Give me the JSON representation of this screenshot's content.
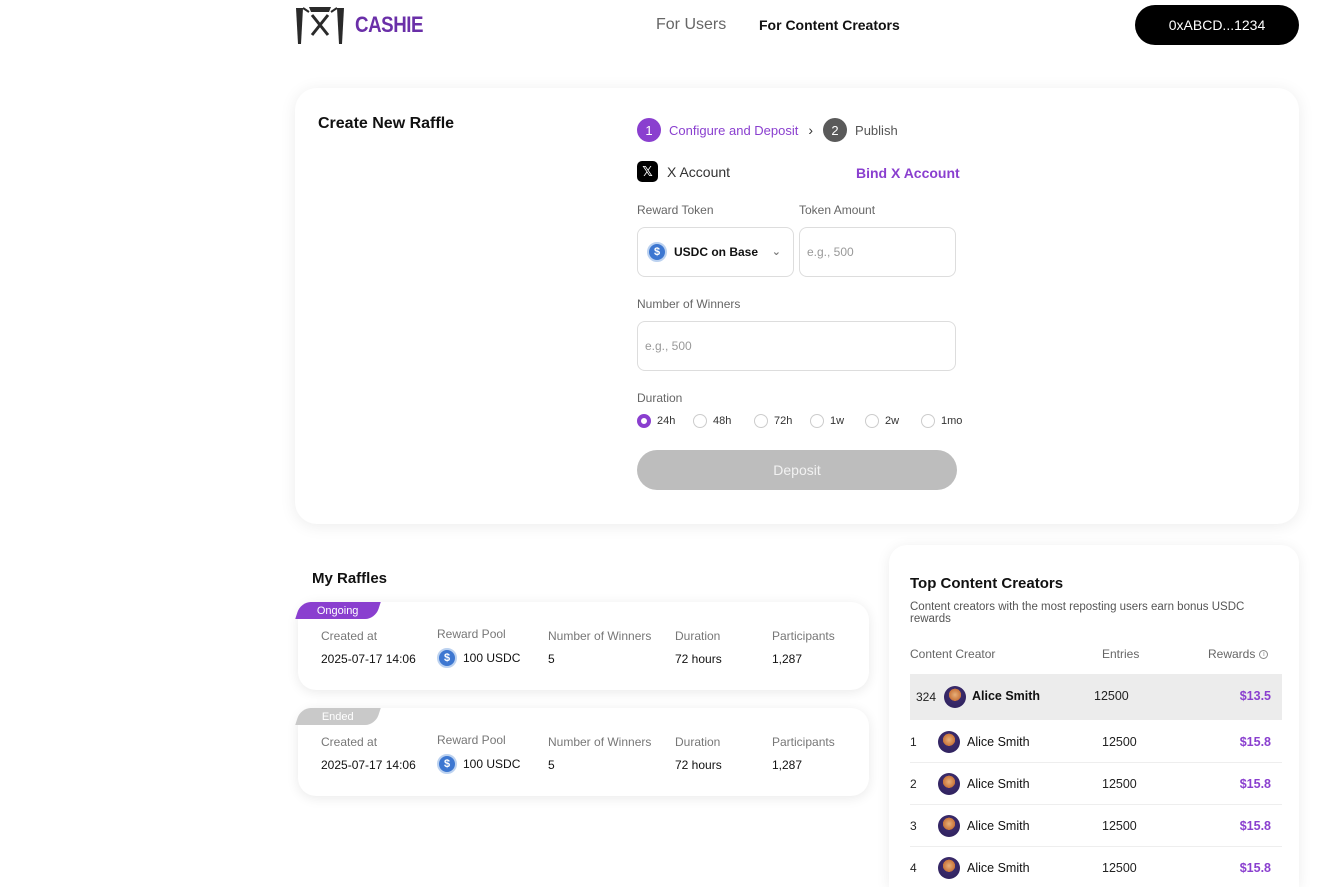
{
  "header": {
    "brand": "CASHIE",
    "nav": [
      {
        "label": "For Users"
      },
      {
        "label": "For Content Creators"
      }
    ],
    "wallet": "0xABCD...1234"
  },
  "create": {
    "title": "Create New Raffle",
    "steps": [
      {
        "num": "1",
        "label": "Configure and Deposit"
      },
      {
        "num": "2",
        "label": "Publish"
      }
    ],
    "x_account": "X Account",
    "bind_x": "Bind X Account",
    "reward_token_label": "Reward Token",
    "reward_token_value": "USDC on Base",
    "token_amount_label": "Token Amount",
    "token_amount_placeholder": "e.g., 500",
    "winners_label": "Number of Winners",
    "winners_placeholder": "e.g., 500",
    "duration_label": "Duration",
    "durations": [
      "24h",
      "48h",
      "72h",
      "1w",
      "2w",
      "1mo"
    ],
    "selected_duration": "24h",
    "deposit_label": "Deposit"
  },
  "raffles": {
    "title": "My Raffles",
    "headers": {
      "created": "Created at",
      "pool": "Reward Pool",
      "winners": "Number of Winners",
      "duration": "Duration",
      "participants": "Participants"
    },
    "items": [
      {
        "status": "Ongoing",
        "created": "2025-07-17 14:06",
        "pool": "100 USDC",
        "winners": "5",
        "duration": "72 hours",
        "participants": "1,287"
      },
      {
        "status": "Ended",
        "created": "2025-07-17 14:06",
        "pool": "100 USDC",
        "winners": "5",
        "duration": "72 hours",
        "participants": "1,287"
      }
    ]
  },
  "top": {
    "title": "Top Content Creators",
    "subtitle": "Content creators with the most reposting users earn bonus USDC rewards",
    "headers": {
      "creator": "Content Creator",
      "entries": "Entries",
      "rewards": "Rewards"
    },
    "me": {
      "rank": "324",
      "name": "Alice Smith",
      "entries": "12500",
      "reward": "$13.5"
    },
    "rows": [
      {
        "rank": "1",
        "name": "Alice Smith",
        "entries": "12500",
        "reward": "$15.8"
      },
      {
        "rank": "2",
        "name": "Alice Smith",
        "entries": "12500",
        "reward": "$15.8"
      },
      {
        "rank": "3",
        "name": "Alice Smith",
        "entries": "12500",
        "reward": "$15.8"
      },
      {
        "rank": "4",
        "name": "Alice Smith",
        "entries": "12500",
        "reward": "$15.8"
      }
    ]
  },
  "colors": {
    "accent": "#8a3fcf",
    "wallet_bg": "#000000",
    "disabled": "#bdbdbd"
  }
}
